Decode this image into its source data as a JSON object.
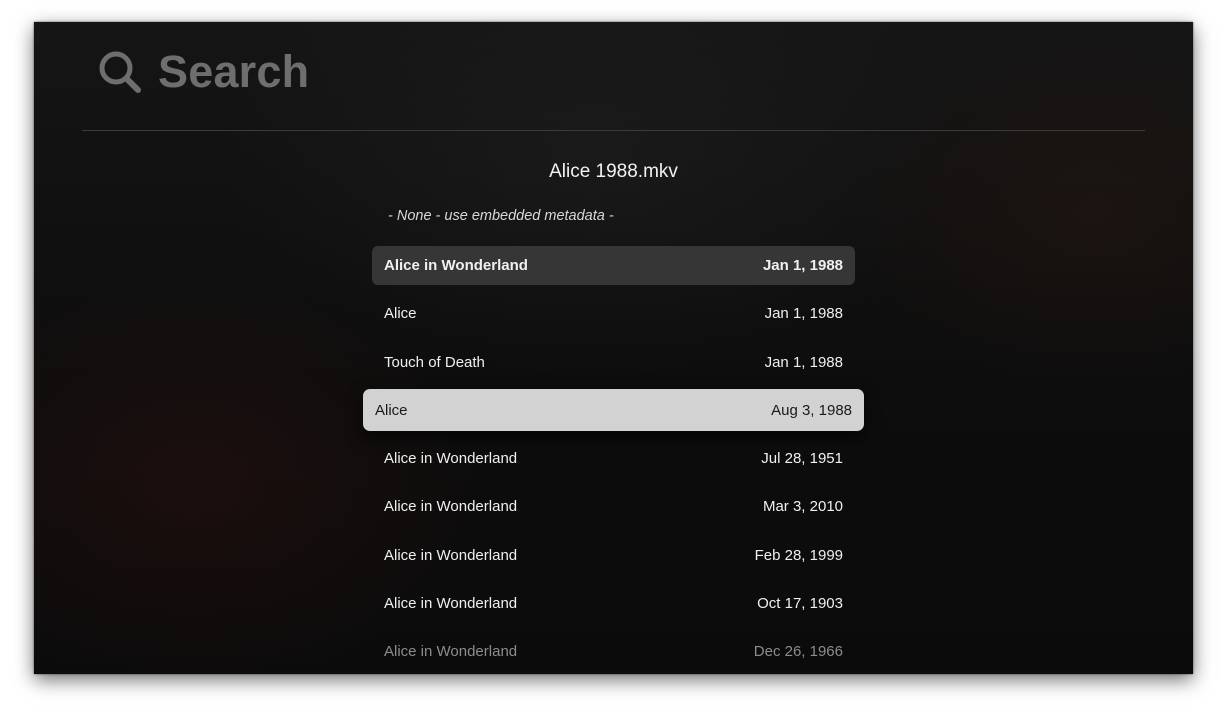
{
  "search": {
    "label": "Search",
    "icon": "search-icon"
  },
  "file": {
    "name": "Alice 1988.mkv"
  },
  "none_option": "- None - use embedded metadata -",
  "results": [
    {
      "title": "Alice in Wonderland",
      "date": "Jan 1, 1988",
      "state": "highlight"
    },
    {
      "title": "Alice",
      "date": "Jan 1, 1988",
      "state": "normal"
    },
    {
      "title": "Touch of Death",
      "date": "Jan 1, 1988",
      "state": "normal"
    },
    {
      "title": "Alice",
      "date": "Aug 3, 1988",
      "state": "focused"
    },
    {
      "title": "Alice in Wonderland",
      "date": "Jul 28, 1951",
      "state": "normal"
    },
    {
      "title": "Alice in Wonderland",
      "date": "Mar 3, 2010",
      "state": "normal"
    },
    {
      "title": "Alice in Wonderland",
      "date": "Feb 28, 1999",
      "state": "normal"
    },
    {
      "title": "Alice in Wonderland",
      "date": "Oct 17, 1903",
      "state": "normal"
    },
    {
      "title": "Alice in Wonderland",
      "date": "Dec 26, 1966",
      "state": "faded"
    }
  ],
  "colors": {
    "background": "#0d0d0d",
    "focused_row": "#d2d2d2",
    "highlight_row": "#363636",
    "search_text": "#6e6e6e"
  }
}
